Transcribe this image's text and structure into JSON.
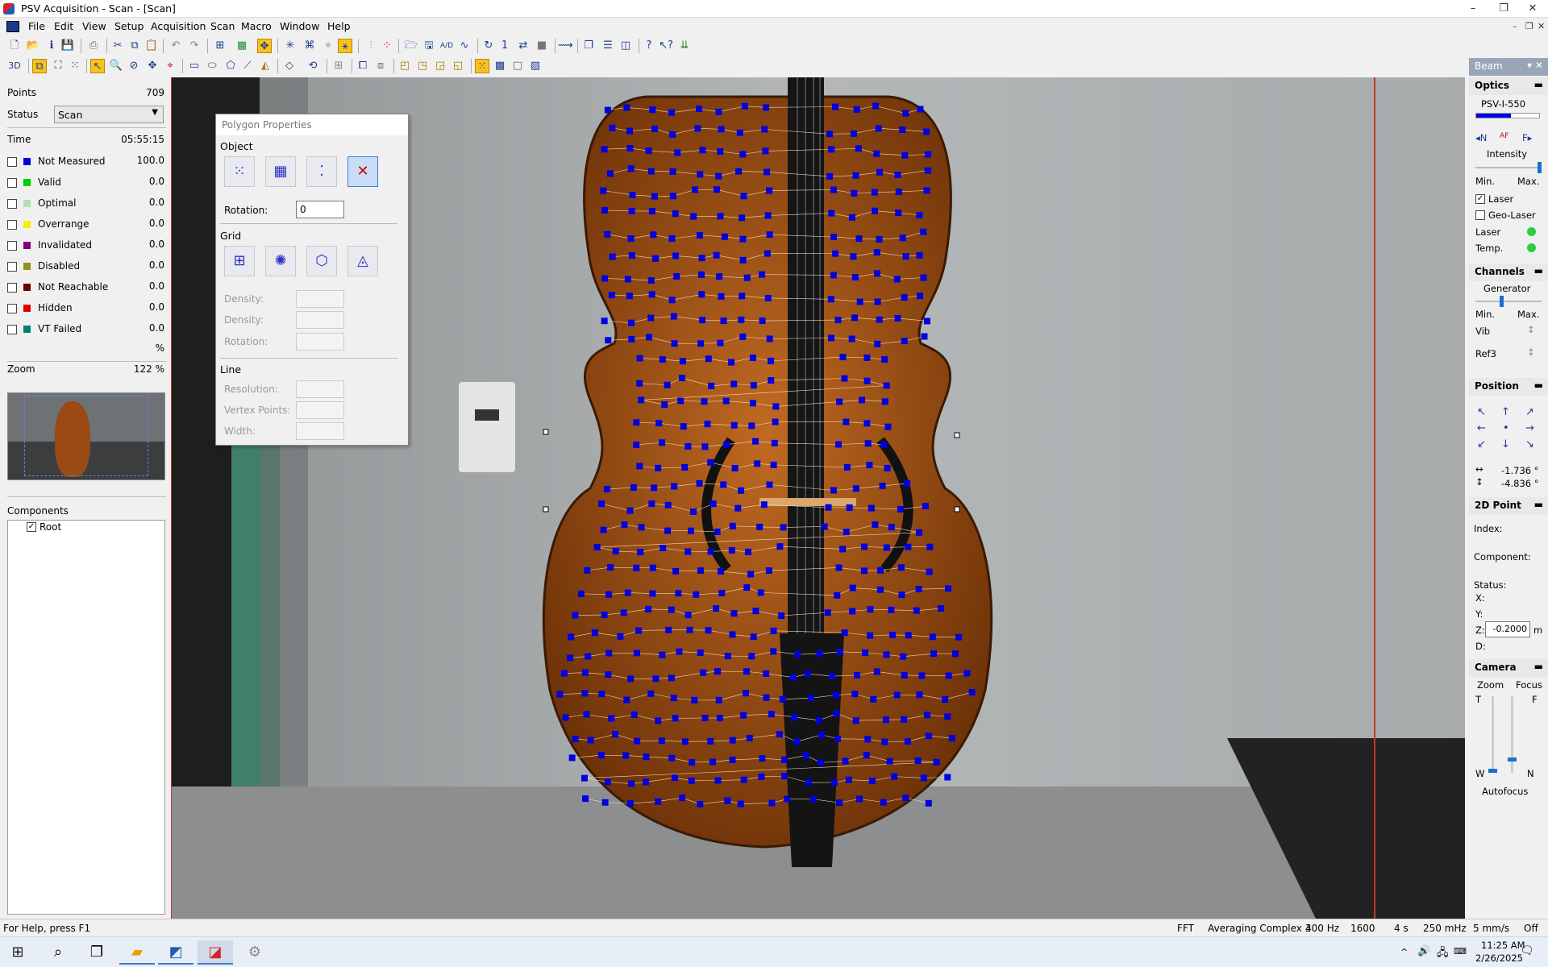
{
  "window": {
    "title": "PSV Acquisition - Scan - [Scan]",
    "minimize": "–",
    "restore": "❐",
    "close": "✕"
  },
  "menu": [
    "File",
    "Edit",
    "View",
    "Setup",
    "Acquisition",
    "Scan",
    "Macro",
    "Window",
    "Help"
  ],
  "mdi_controls": {
    "minimize": "–",
    "restore": "❐",
    "close": "✕"
  },
  "toolbar": {
    "mode_3d": "3D"
  },
  "left_panel": {
    "points_label": "Points",
    "points_value": "709",
    "status_label": "Status",
    "status_value": "Scan",
    "time_label": "Time",
    "time_value": "05:55:15",
    "legend": [
      {
        "label": "Not Measured",
        "value": "100.0",
        "color": "#0000e0"
      },
      {
        "label": "Valid",
        "value": "0.0",
        "color": "#00d000"
      },
      {
        "label": "Optimal",
        "value": "0.0",
        "color": "#b0e0b0"
      },
      {
        "label": "Overrange",
        "value": "0.0",
        "color": "#f0f000"
      },
      {
        "label": "Invalidated",
        "value": "0.0",
        "color": "#800080"
      },
      {
        "label": "Disabled",
        "value": "0.0",
        "color": "#909020"
      },
      {
        "label": "Not Reachable",
        "value": "0.0",
        "color": "#700000"
      },
      {
        "label": "Hidden",
        "value": "0.0",
        "color": "#e00000"
      },
      {
        "label": "VT Failed",
        "value": "0.0",
        "color": "#008070"
      }
    ],
    "unit": "%",
    "zoom_label": "Zoom",
    "zoom_value": "122 %",
    "components_label": "Components",
    "tree_root": "Root"
  },
  "polygon_dialog": {
    "title": "Polygon Properties",
    "object": "Object",
    "rotation_label": "Rotation:",
    "rotation_value": "0",
    "grid": "Grid",
    "density1": "Density:",
    "density2": "Density:",
    "rotation2": "Rotation:",
    "line": "Line",
    "resolution": "Resolution:",
    "vertex_points": "Vertex Points:",
    "width": "Width:"
  },
  "right_panel": {
    "header": "Beam",
    "optics": "Optics",
    "device": "PSV-I-550",
    "nav_n": "◂N",
    "nav_af": "AF",
    "nav_f": "F▸",
    "intensity": "Intensity",
    "min": "Min.",
    "max": "Max.",
    "laser_chk": "Laser",
    "geo_laser": "Geo-Laser",
    "laser_status": "Laser",
    "temp_status": "Temp.",
    "status_ok_color": "#2ecc40",
    "channels": "Channels",
    "generator": "Generator",
    "min2": "Min.",
    "max2": "Max.",
    "vib": "Vib",
    "ref3": "Ref3",
    "position": "Position",
    "pos_h": "-1.736 °",
    "pos_v": "-4.836 °",
    "point2d": "2D Point",
    "index": "Index:",
    "component": "Component:",
    "status": "Status:",
    "x": "X:",
    "y": "Y:",
    "z": "Z:",
    "z_value": "-0.2000",
    "z_unit": "m",
    "d": "D:",
    "camera": "Camera",
    "zoom": "Zoom",
    "focus": "Focus",
    "t": "T",
    "f": "F",
    "w": "W",
    "n": "N",
    "autofocus": "Autofocus"
  },
  "status_bar": {
    "help": "For Help, press F1",
    "fft": "FFT",
    "averaging": "Averaging Complex 3",
    "bandwidth": "400 Hz",
    "lines": "1600",
    "time": "4 s",
    "velocity_range": "250 mHz",
    "mm_s": "5 mm/s",
    "off": "Off"
  },
  "taskbar": {
    "time": "11:25 AM",
    "date": "2/26/2025"
  }
}
